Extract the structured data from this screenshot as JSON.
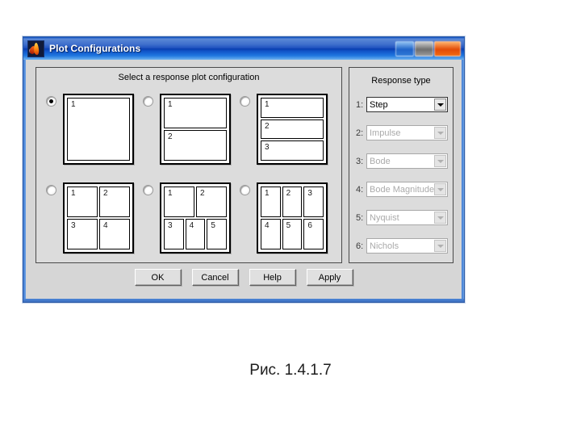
{
  "window": {
    "title": "Plot Configurations",
    "app_icon": "matlab-membrane-icon",
    "buttons": {
      "minimize": "minimize-button",
      "maximize": "maximize-button",
      "close": "close-button"
    }
  },
  "config_panel": {
    "title": "Select a response plot configuration",
    "selected_index": 0,
    "options": [
      {
        "id": 1,
        "selected": true,
        "layout": "1x1",
        "panes": [
          [
            "1"
          ]
        ]
      },
      {
        "id": 2,
        "selected": false,
        "layout": "2-stack",
        "panes": [
          [
            "1"
          ],
          [
            "2"
          ]
        ]
      },
      {
        "id": 3,
        "selected": false,
        "layout": "3-stack",
        "panes": [
          [
            "1"
          ],
          [
            "2"
          ],
          [
            "3"
          ]
        ]
      },
      {
        "id": 4,
        "selected": false,
        "layout": "2x2",
        "panes": [
          [
            "1",
            "2"
          ],
          [
            "3",
            "4"
          ]
        ]
      },
      {
        "id": 5,
        "selected": false,
        "layout": "2-over-3",
        "panes": [
          [
            "1",
            "2"
          ],
          [
            "3",
            "4",
            "5"
          ]
        ]
      },
      {
        "id": 6,
        "selected": false,
        "layout": "3x2",
        "panes": [
          [
            "1",
            "2",
            "3"
          ],
          [
            "4",
            "5",
            "6"
          ]
        ]
      }
    ]
  },
  "response_panel": {
    "title": "Response type",
    "rows": [
      {
        "index": "1:",
        "value": "Step",
        "enabled": true
      },
      {
        "index": "2:",
        "value": "Impulse",
        "enabled": false
      },
      {
        "index": "3:",
        "value": "Bode",
        "enabled": false
      },
      {
        "index": "4:",
        "value": "Bode Magnitude",
        "enabled": false
      },
      {
        "index": "5:",
        "value": "Nyquist",
        "enabled": false
      },
      {
        "index": "6:",
        "value": "Nichols",
        "enabled": false
      }
    ]
  },
  "dialog_buttons": [
    {
      "label": "OK",
      "name": "ok-button"
    },
    {
      "label": "Cancel",
      "name": "cancel-button"
    },
    {
      "label": "Help",
      "name": "help-button"
    },
    {
      "label": "Apply",
      "name": "apply-button"
    }
  ],
  "caption": "Рис. 1.4.1.7",
  "colors": {
    "titlebar_blue": "#1f52bf",
    "dialog_gray": "#d6d6d6",
    "panel_gray": "#dcdcdc",
    "close_red": "#e24a07",
    "disabled_text": "#aaaaaa"
  }
}
